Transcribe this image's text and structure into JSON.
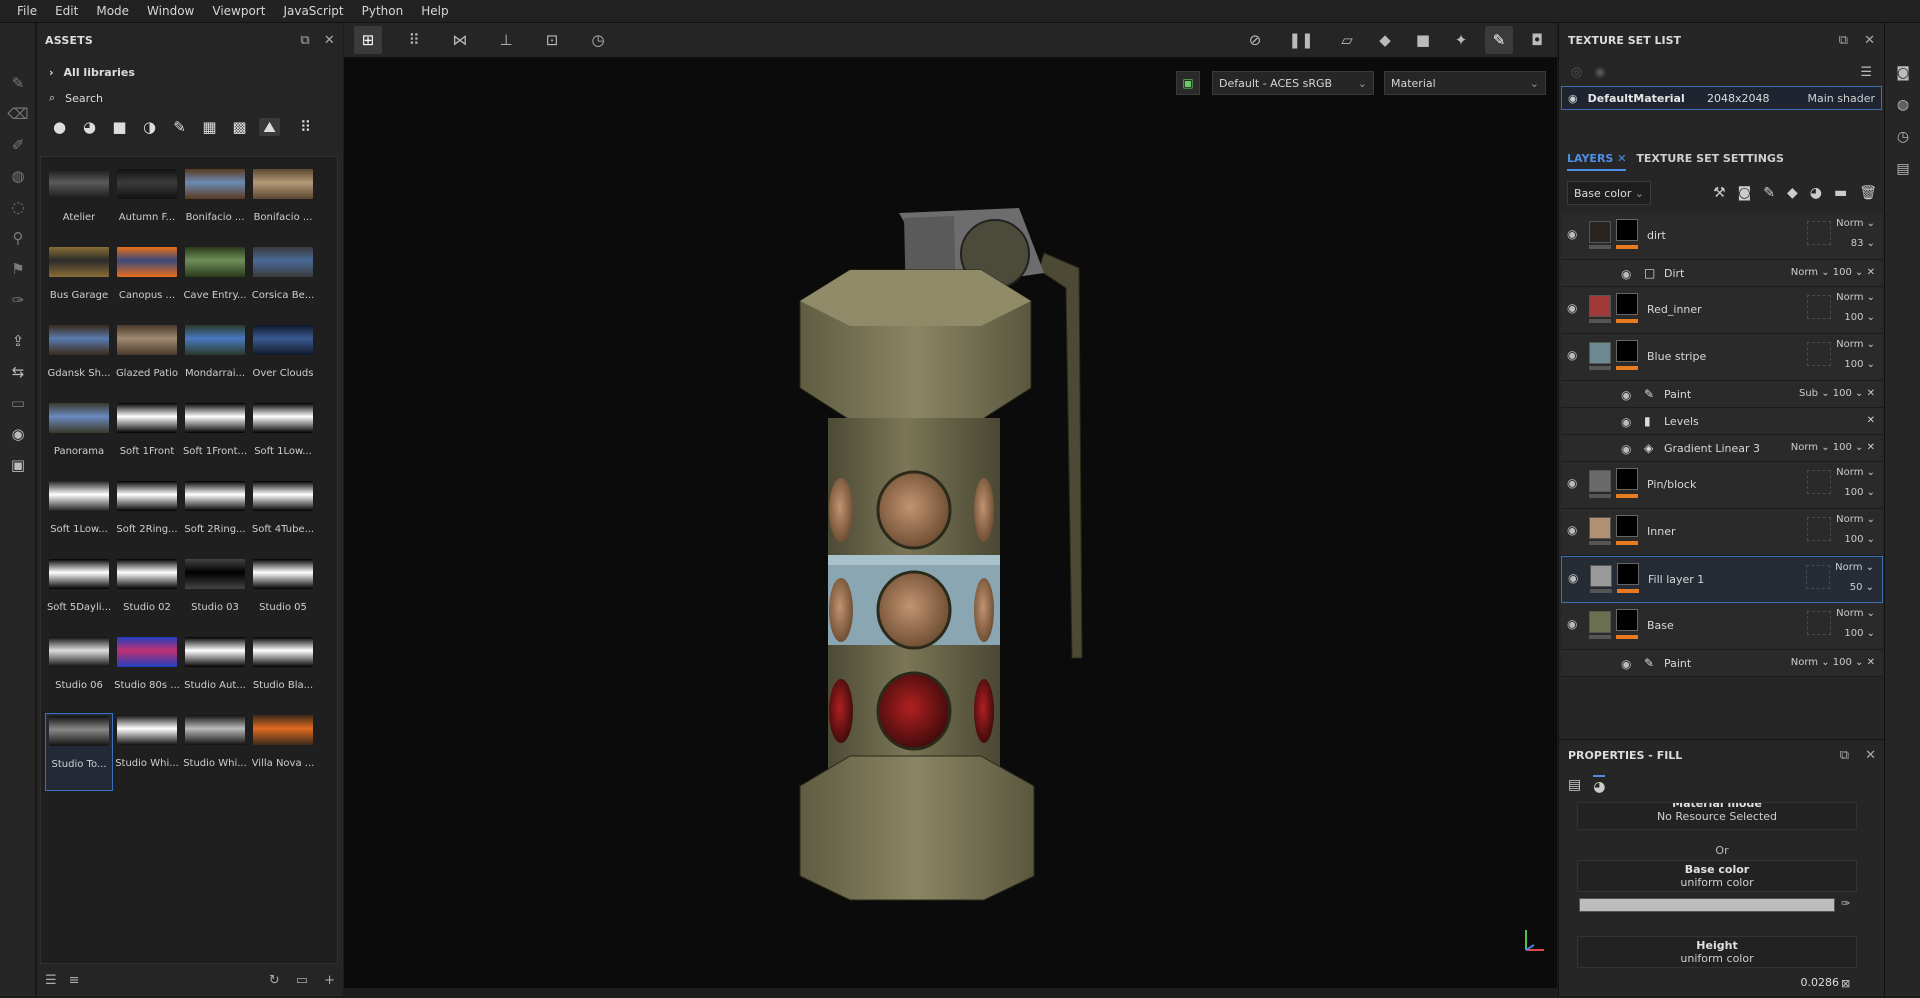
{
  "menu": [
    "File",
    "Edit",
    "Mode",
    "Window",
    "Viewport",
    "JavaScript",
    "Python",
    "Help"
  ],
  "assets": {
    "title": "ASSETS",
    "all_libraries": "All libraries",
    "search_placeholder": "Search",
    "items": [
      {
        "label": "Atelier",
        "c1": "#5a5a5a",
        "c2": "#1a1a1a"
      },
      {
        "label": "Autumn F...",
        "c1": "#3b3b3b",
        "c2": "#111"
      },
      {
        "label": "Bonifacio ...",
        "c1": "#6b8bb6",
        "c2": "#5a3a1e"
      },
      {
        "label": "Bonifacio ...",
        "c1": "#b59a78",
        "c2": "#5b4630"
      },
      {
        "label": "Bus Garage",
        "c1": "#2b2b2b",
        "c2": "#8a6e35"
      },
      {
        "label": "Canopus ...",
        "c1": "#3a4a7a",
        "c2": "#e86e1c"
      },
      {
        "label": "Cave Entry...",
        "c1": "#6f8f5a",
        "c2": "#2a3a1a"
      },
      {
        "label": "Corsica Be...",
        "c1": "#4a6a9a",
        "c2": "#3a3a3a"
      },
      {
        "label": "Gdansk Sh...",
        "c1": "#5a7ab0",
        "c2": "#3b2a1a"
      },
      {
        "label": "Glazed Patio",
        "c1": "#a08a70",
        "c2": "#4a3a2a"
      },
      {
        "label": "Mondarrai...",
        "c1": "#4a78c0",
        "c2": "#2a3a2a"
      },
      {
        "label": "Over Clouds",
        "c1": "#3a5a90",
        "c2": "#10182a"
      },
      {
        "label": "Panorama",
        "c1": "#6a8ac0",
        "c2": "#3a3a2a"
      },
      {
        "label": "Soft 1Front",
        "c1": "#ffffff",
        "c2": "#000000"
      },
      {
        "label": "Soft 1Front...",
        "c1": "#ffffff",
        "c2": "#000000"
      },
      {
        "label": "Soft 1Low...",
        "c1": "#ffffff",
        "c2": "#000000"
      },
      {
        "label": "Soft 1Low...",
        "c1": "#ffffff",
        "c2": "#222"
      },
      {
        "label": "Soft 2Ring...",
        "c1": "#ffffff",
        "c2": "#000"
      },
      {
        "label": "Soft 2Ring...",
        "c1": "#ffffff",
        "c2": "#000"
      },
      {
        "label": "Soft 4Tube...",
        "c1": "#ffffff",
        "c2": "#000"
      },
      {
        "label": "Soft 5Dayli...",
        "c1": "#ffffff",
        "c2": "#000"
      },
      {
        "label": "Studio 02",
        "c1": "#ffffff",
        "c2": "#000"
      },
      {
        "label": "Studio 03",
        "c1": "#000000",
        "c2": "#444"
      },
      {
        "label": "Studio 05",
        "c1": "#ffffff",
        "c2": "#000"
      },
      {
        "label": "Studio 06",
        "c1": "#dddddd",
        "c2": "#111"
      },
      {
        "label": "Studio 80s ...",
        "c1": "#c03070",
        "c2": "#2040c0"
      },
      {
        "label": "Studio Aut...",
        "c1": "#ffffff",
        "c2": "#000"
      },
      {
        "label": "Studio Bla...",
        "c1": "#ffffff",
        "c2": "#000"
      },
      {
        "label": "Studio To...",
        "c1": "#888888",
        "c2": "#111",
        "selected": true
      },
      {
        "label": "Studio Whi...",
        "c1": "#ffffff",
        "c2": "#111"
      },
      {
        "label": "Studio Whi...",
        "c1": "#bbbbbb",
        "c2": "#111"
      },
      {
        "label": "Villa Nova ...",
        "c1": "#e06a20",
        "c2": "#3a2a1a"
      }
    ]
  },
  "viewport": {
    "colorspace": "Default - ACES sRGB",
    "mode": "Material"
  },
  "texture_set_list": {
    "title": "TEXTURE SET LIST",
    "material": "DefaultMaterial",
    "resolution": "2048x2048",
    "shader": "Main shader"
  },
  "layers_panel": {
    "tab_layers": "LAYERS",
    "tab_settings": "TEXTURE SET SETTINGS",
    "channel": "Base color",
    "layers": [
      {
        "name": "dirt",
        "blend": "Norm",
        "opacity": "83",
        "swatch": "#2c2420",
        "subs": [
          {
            "name": "Dirt",
            "blend": "Norm",
            "opacity": "100",
            "icon": "□"
          }
        ]
      },
      {
        "name": "Red_inner",
        "blend": "Norm",
        "opacity": "100",
        "swatch": "#a03a3a",
        "subs": []
      },
      {
        "name": "Blue stripe",
        "blend": "Norm",
        "opacity": "100",
        "swatch": "#6a8a90",
        "subs": [
          {
            "name": "Paint",
            "blend": "Sub",
            "opacity": "100",
            "icon": "✎"
          },
          {
            "name": "Levels",
            "blend": "",
            "opacity": "",
            "icon": "▮"
          },
          {
            "name": "Gradient Linear 3",
            "blend": "Norm",
            "opacity": "100",
            "icon": "◈"
          }
        ]
      },
      {
        "name": "Pin/block",
        "blend": "Norm",
        "opacity": "100",
        "swatch": "#6a6a6a",
        "subs": []
      },
      {
        "name": "Inner",
        "blend": "Norm",
        "opacity": "100",
        "swatch": "#b09070",
        "subs": []
      },
      {
        "name": "Fill layer 1",
        "blend": "Norm",
        "opacity": "50",
        "swatch": "#9a9a9a",
        "selected": true,
        "subs": []
      },
      {
        "name": "Base",
        "blend": "Norm",
        "opacity": "100",
        "swatch": "#6a7050",
        "subs": [
          {
            "name": "Paint",
            "blend": "Norm",
            "opacity": "100",
            "icon": "✎"
          }
        ]
      }
    ]
  },
  "properties": {
    "title": "PROPERTIES - FILL",
    "material_mode_label": "Material mode",
    "material_none": "No Resource Selected",
    "or": "Or",
    "base_color_title": "Base color",
    "base_color_sub": "uniform color",
    "height_title": "Height",
    "height_sub": "uniform color",
    "height_value": "0.0286"
  }
}
